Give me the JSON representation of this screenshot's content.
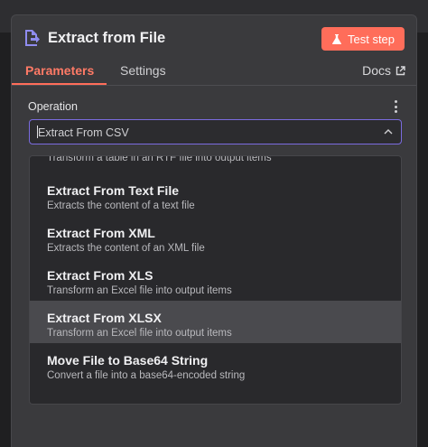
{
  "node": {
    "title": "Extract from File",
    "icon": "file-export-icon",
    "test_button_label": "Test step"
  },
  "tabs": [
    {
      "label": "Parameters",
      "active": true
    },
    {
      "label": "Settings",
      "active": false
    }
  ],
  "docs_label": "Docs",
  "operation": {
    "label": "Operation",
    "value": "Extract From CSV"
  },
  "dropdown": {
    "partial_item_desc": "Transform a table in an RTF file into output items",
    "items": [
      {
        "title": "Extract From Text File",
        "desc": "Extracts the content of a text file"
      },
      {
        "title": "Extract From XML",
        "desc": "Extracts the content of an XML file"
      },
      {
        "title": "Extract From XLS",
        "desc": "Transform an Excel file into output items"
      },
      {
        "title": "Extract From XLSX",
        "desc": "Transform an Excel file into output items",
        "highlighted": true
      },
      {
        "title": "Move File to Base64 String",
        "desc": "Convert a file into a base64-encoded string"
      }
    ]
  },
  "colors": {
    "accent": "#ff6d5a",
    "focus_border": "#7b6ce0",
    "panel_bg": "#3a3a3d",
    "dropdown_bg": "#29292c",
    "highlight_bg": "#4a4a4e"
  }
}
